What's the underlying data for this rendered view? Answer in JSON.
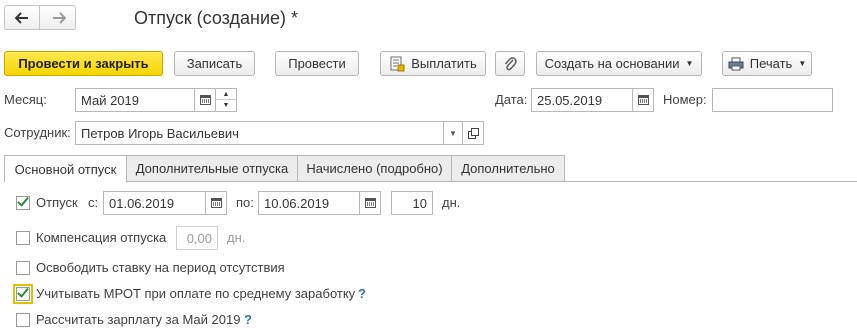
{
  "window": {
    "title": "Отпуск (создание) *"
  },
  "nav": {
    "back_icon": "arrow-left-icon",
    "forward_icon": "arrow-right-icon"
  },
  "toolbar": {
    "post_close": "Провести и закрыть",
    "save": "Записать",
    "post": "Провести",
    "pay": "Выплатить",
    "create_based": "Создать на основании",
    "print": "Печать",
    "accent_color": "#f5d500"
  },
  "form": {
    "month_label": "Месяц:",
    "month_value": "Май 2019",
    "date_label": "Дата:",
    "date_value": "25.05.2019",
    "number_label": "Номер:",
    "number_value": "",
    "employee_label": "Сотрудник:",
    "employee_value": "Петров Игорь Васильевич"
  },
  "tabs": [
    {
      "label": "Основной отпуск",
      "active": true
    },
    {
      "label": "Дополнительные отпуска",
      "active": false
    },
    {
      "label": "Начислено (подробно)",
      "active": false
    },
    {
      "label": "Дополнительно",
      "active": false
    }
  ],
  "vacation": {
    "label": "Отпуск",
    "checked": true,
    "from_label": "с:",
    "from_value": "01.06.2019",
    "to_label": "по:",
    "to_value": "10.06.2019",
    "days_value": "10",
    "days_unit": "дн."
  },
  "compensation": {
    "label": "Компенсация отпуска",
    "checked": false,
    "value": "0,00",
    "unit": "дн."
  },
  "release_rate": {
    "label": "Освободить ставку на период отсутствия",
    "checked": false
  },
  "mrot": {
    "label": "Учитывать МРОТ при оплате по среднему заработку",
    "checked": true,
    "help": "?"
  },
  "calc_salary": {
    "label": "Рассчитать зарплату за Май 2019",
    "checked": false,
    "help": "?"
  }
}
